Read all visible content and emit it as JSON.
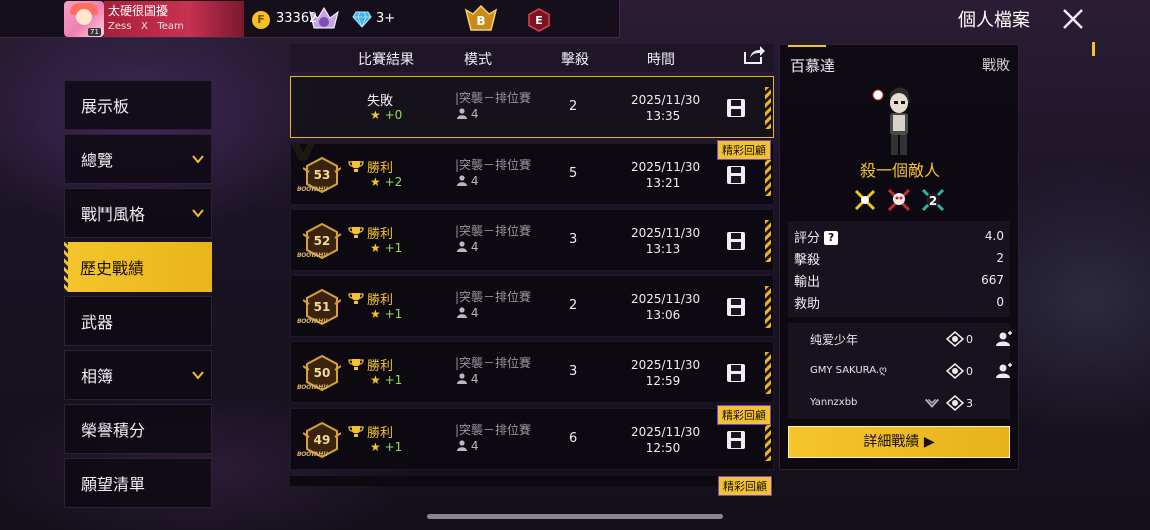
{
  "profile": {
    "nickname": "太硬很国擾",
    "clan_line": "Zess   X   Team",
    "level": "71",
    "coins": "33362",
    "diamonds": "3+",
    "rank_b": "B",
    "rank_e": "E"
  },
  "window": {
    "title": "個人檔案"
  },
  "sidebar": {
    "items": [
      {
        "label": "展示板",
        "chevron": false,
        "active": false
      },
      {
        "label": "總覽",
        "chevron": true,
        "active": false
      },
      {
        "label": "戰鬥風格",
        "chevron": true,
        "active": false
      },
      {
        "label": "歷史戰績",
        "chevron": false,
        "active": true
      },
      {
        "label": "武器",
        "chevron": false,
        "active": false
      },
      {
        "label": "相簿",
        "chevron": true,
        "active": false
      },
      {
        "label": "榮譽積分",
        "chevron": false,
        "active": false
      },
      {
        "label": "願望清單",
        "chevron": false,
        "active": false
      }
    ]
  },
  "table": {
    "headers": {
      "result": "比賽結果",
      "mode": "模式",
      "kills": "擊殺",
      "time": "時間"
    },
    "rows": [
      {
        "level": "",
        "result": "失敗",
        "win": false,
        "stars": "+0",
        "mode": "|突襲－排位賽",
        "players": "4",
        "kills": "2",
        "date": "2025/11/30",
        "time": "13:35",
        "highlight": ""
      },
      {
        "level": "53",
        "result": "勝利",
        "win": true,
        "stars": "+2",
        "mode": "|突襲－排位賽",
        "players": "4",
        "kills": "5",
        "date": "2025/11/30",
        "time": "13:21",
        "highlight": "精彩回顧"
      },
      {
        "level": "52",
        "result": "勝利",
        "win": true,
        "stars": "+1",
        "mode": "|突襲－排位賽",
        "players": "4",
        "kills": "3",
        "date": "2025/11/30",
        "time": "13:13",
        "highlight": ""
      },
      {
        "level": "51",
        "result": "勝利",
        "win": true,
        "stars": "+1",
        "mode": "|突襲－排位賽",
        "players": "4",
        "kills": "2",
        "date": "2025/11/30",
        "time": "13:06",
        "highlight": ""
      },
      {
        "level": "50",
        "result": "勝利",
        "win": true,
        "stars": "+1",
        "mode": "|突襲－排位賽",
        "players": "4",
        "kills": "3",
        "date": "2025/11/30",
        "time": "12:59",
        "highlight": ""
      },
      {
        "level": "49",
        "result": "勝利",
        "win": true,
        "stars": "+1",
        "mode": "|突襲－排位賽",
        "players": "4",
        "kills": "6",
        "date": "2025/11/30",
        "time": "12:50",
        "highlight": "精彩回顧"
      }
    ],
    "booyah": "BOOYAH!!",
    "next_highlight": "精彩回顧"
  },
  "detail": {
    "player": "百慕達",
    "result": "戰敗",
    "title": "殺一個敵人",
    "medal_count": "2",
    "stats": [
      {
        "label": "評分",
        "value": "4.0",
        "help": true
      },
      {
        "label": "擊殺",
        "value": "2",
        "help": false
      },
      {
        "label": "輸出",
        "value": "667",
        "help": false
      },
      {
        "label": "救助",
        "value": "0",
        "help": false
      }
    ],
    "teammates": [
      {
        "name": "纯爱少年",
        "kills": "0",
        "add": true,
        "small": false
      },
      {
        "name": "GMY   SAKURA.ღ",
        "kills": "0",
        "add": true,
        "small": true
      },
      {
        "name": "Yannzxbb",
        "kills": "3",
        "add": false,
        "small": true
      }
    ],
    "button": "詳細戰績 ▶"
  },
  "colors": {
    "accent": "#f2c230",
    "win": "#f2c230",
    "stars_plus": "#8ee05a"
  }
}
